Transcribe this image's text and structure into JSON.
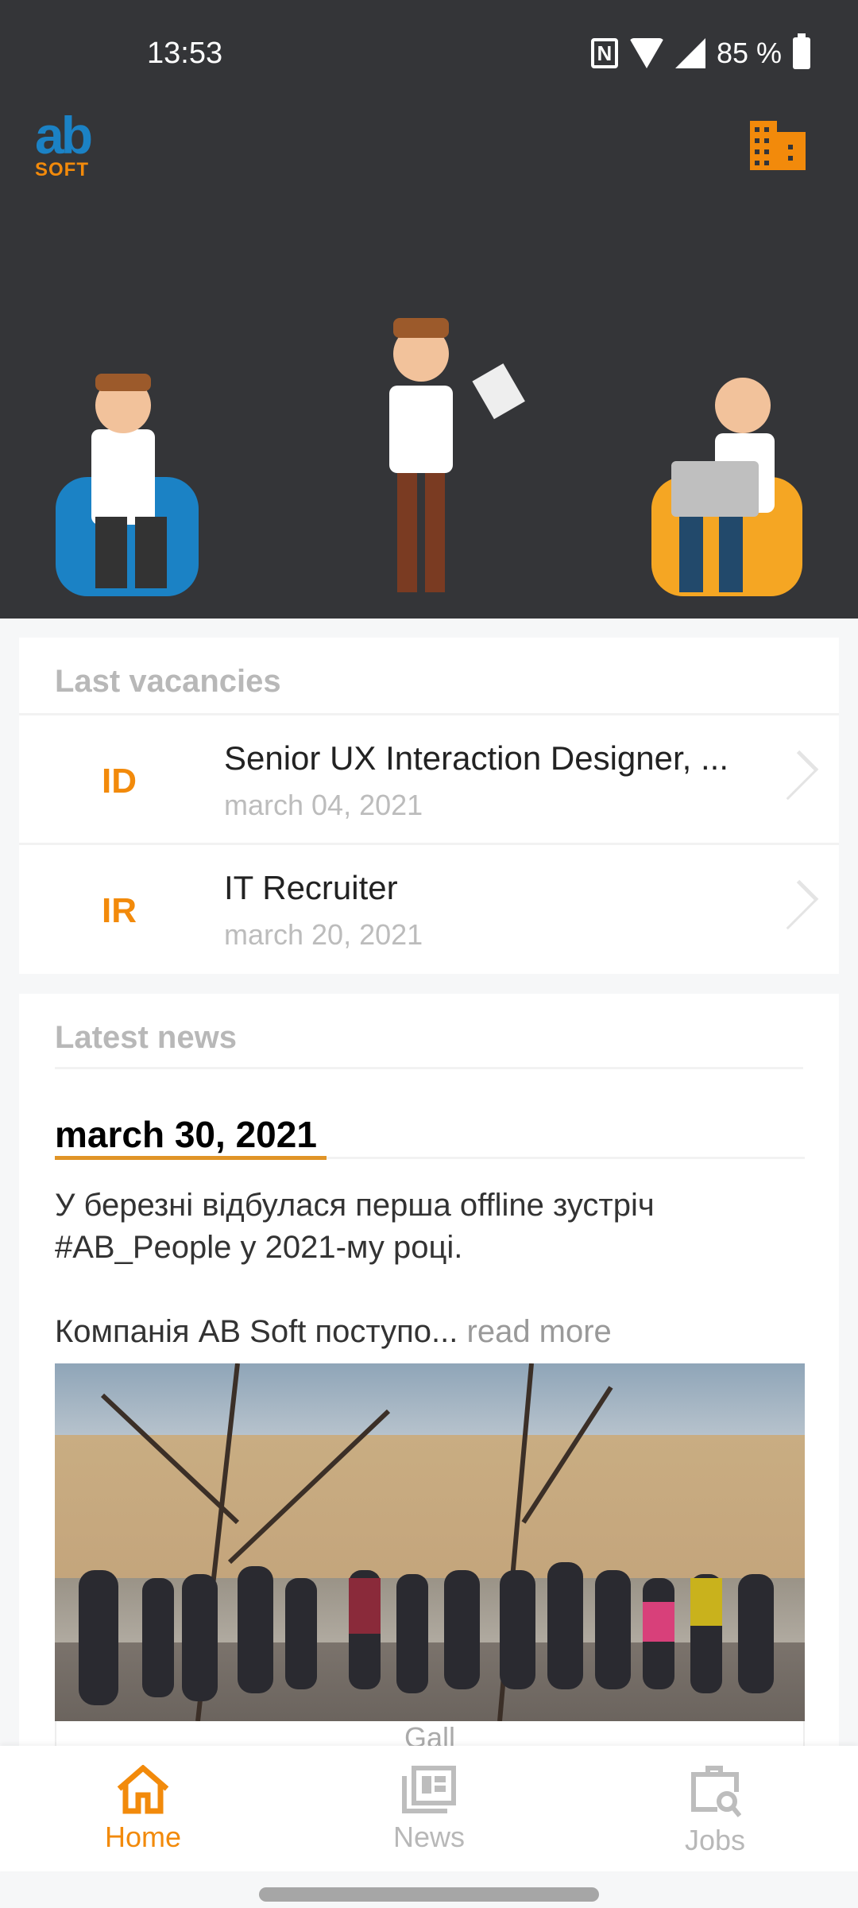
{
  "status_bar": {
    "time": "13:53",
    "battery": "85 %",
    "icons": [
      "nfc-icon",
      "wifi-icon",
      "signal-icon",
      "battery-icon"
    ]
  },
  "header": {
    "logo_text": "ab",
    "logo_sub": "SOFT",
    "building_icon": "building-icon"
  },
  "colors": {
    "accent": "#f28a0b",
    "brand_blue": "#1b82c5",
    "hero_bg": "#343538"
  },
  "vacancies": {
    "title": "Last vacancies",
    "items": [
      {
        "initials": "ID",
        "title": "Senior UX Interaction Designer, ...",
        "date": "march 04, 2021"
      },
      {
        "initials": "IR",
        "title": "IT Recruiter",
        "date": "march 20, 2021"
      }
    ]
  },
  "news": {
    "title": "Latest news",
    "date": "march 30, 2021",
    "line1": "У березні відбулася перша offline зустріч #AB_People у 2021-му році.",
    "line2": "Компанія AB Soft поступо...",
    "read_more": "read more",
    "gallery_label": "Gall"
  },
  "nav": {
    "items": [
      {
        "label": "Home",
        "icon": "home-icon",
        "active": true
      },
      {
        "label": "News",
        "icon": "news-icon"
      },
      {
        "label": "Jobs",
        "icon": "jobs-icon"
      }
    ]
  }
}
